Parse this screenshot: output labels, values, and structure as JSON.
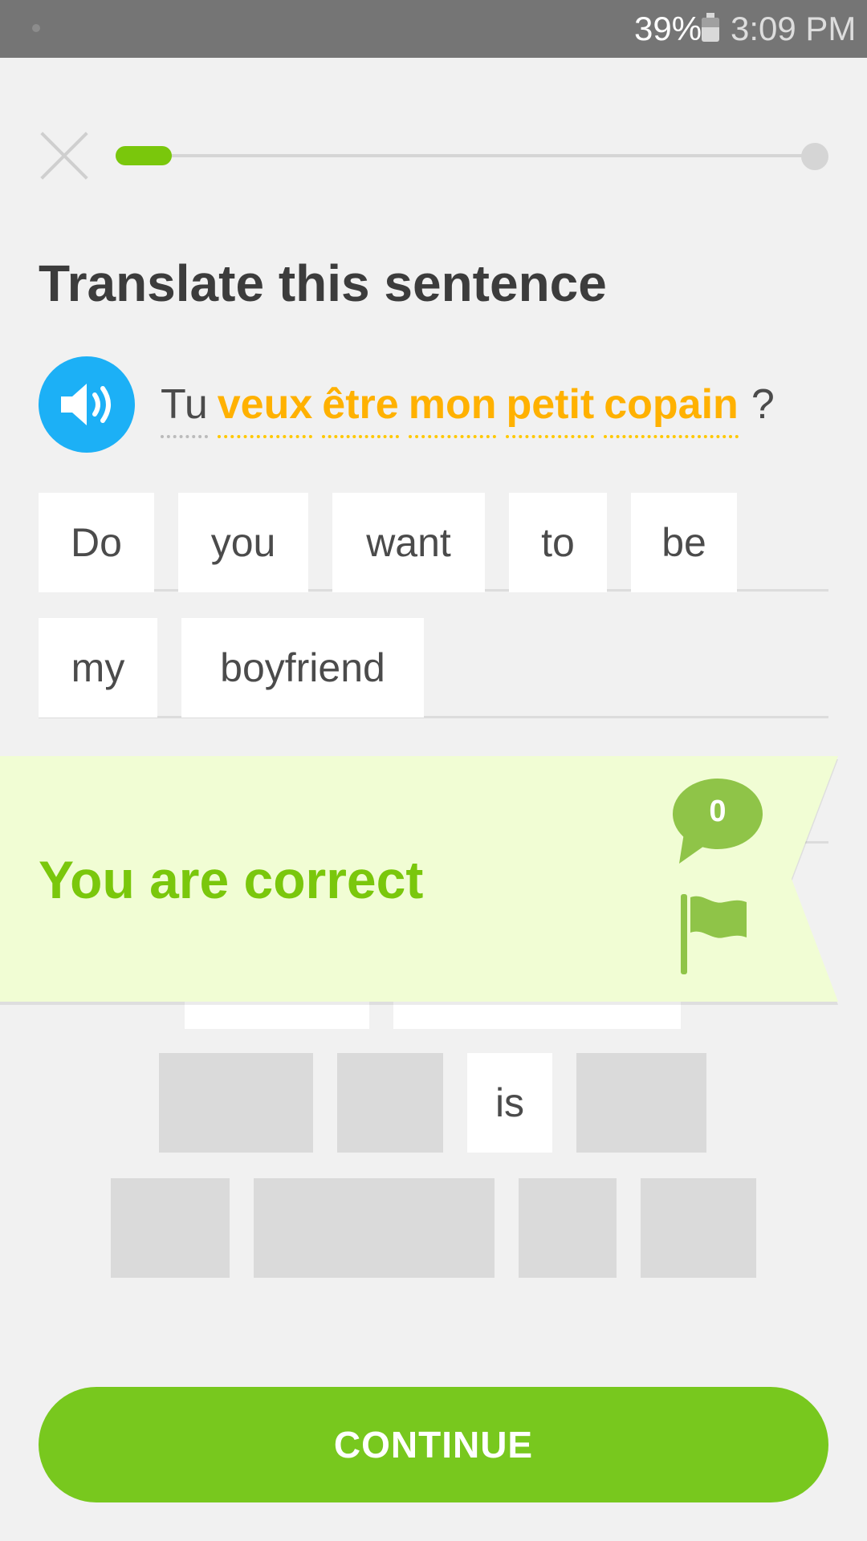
{
  "status_bar": {
    "battery_percent": "39%",
    "time": "3:09 PM"
  },
  "lesson": {
    "progress_fraction": 0.08
  },
  "instruction": "Translate this sentence",
  "prompt": {
    "words": [
      {
        "text": "Tu",
        "highlighted": false
      },
      {
        "text": "veux",
        "highlighted": true
      },
      {
        "text": "être",
        "highlighted": true
      },
      {
        "text": "mon",
        "highlighted": true
      },
      {
        "text": "petit",
        "highlighted": true
      },
      {
        "text": "copain",
        "highlighted": true
      }
    ],
    "punctuation": "?"
  },
  "answer": {
    "tiles": [
      "Do",
      "you",
      "want",
      "to",
      "be",
      "my",
      "boyfriend"
    ]
  },
  "word_bank": {
    "visible_tile": "is"
  },
  "feedback": {
    "message": "You are correct",
    "comment_count": "0"
  },
  "continue_label": "CONTINUE",
  "colors": {
    "accent_green": "#78c81e",
    "feedback_bg": "#f1fdd4",
    "speaker_blue": "#1cb0f6",
    "highlight_gold": "#ffb100"
  }
}
